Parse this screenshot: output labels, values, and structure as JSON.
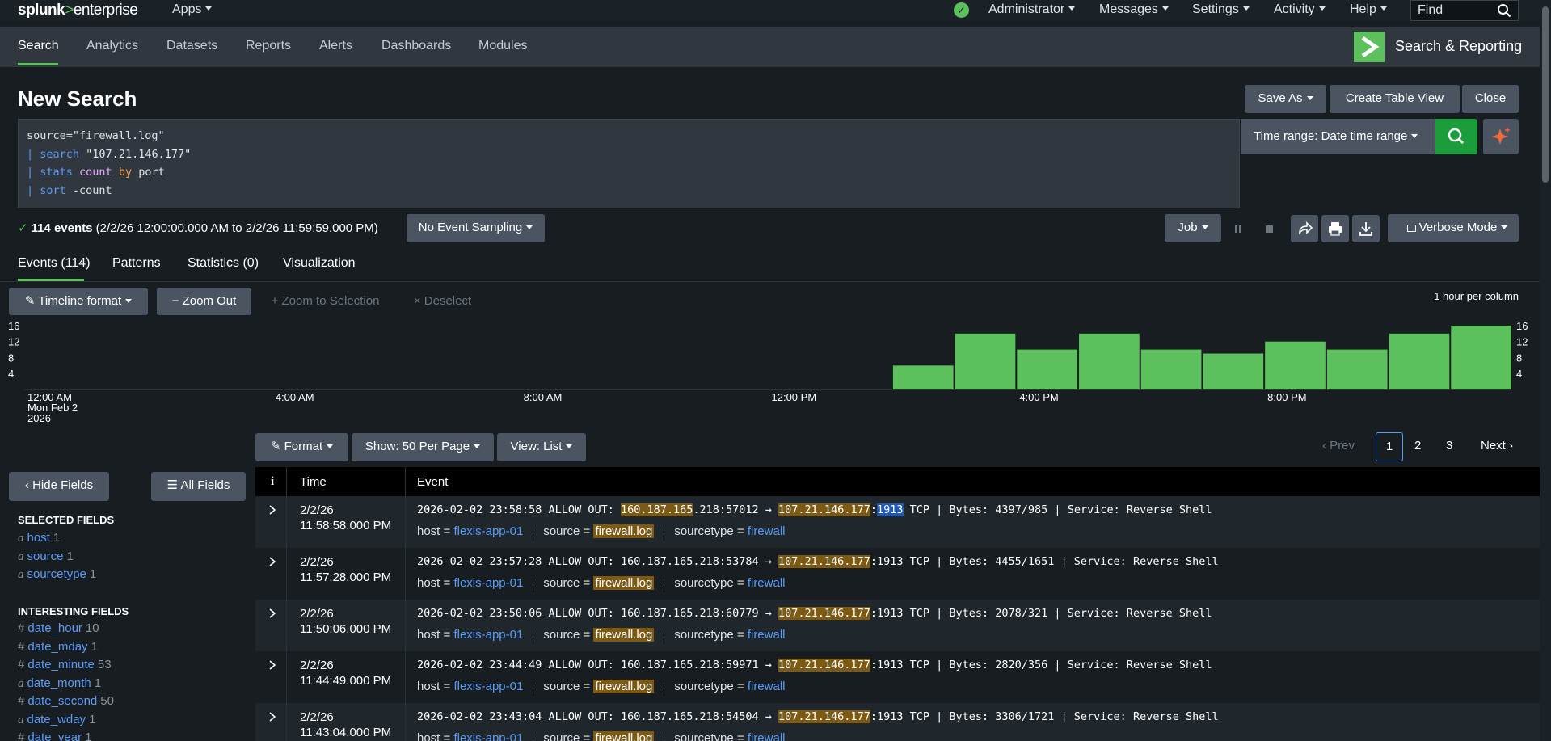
{
  "topbar": {
    "logo_prefix": "splunk",
    "logo_gt": ">",
    "logo_suffix": "enterprise",
    "apps": "Apps",
    "administrator": "Administrator",
    "messages": "Messages",
    "settings": "Settings",
    "activity": "Activity",
    "help": "Help",
    "find_placeholder": "Find"
  },
  "appbar": {
    "tabs": [
      "Search",
      "Analytics",
      "Datasets",
      "Reports",
      "Alerts",
      "Dashboards",
      "Modules"
    ],
    "app_title": "Search & Reporting"
  },
  "page": {
    "title": "New Search",
    "save_as": "Save As",
    "create_table_view": "Create Table View",
    "close": "Close"
  },
  "search": {
    "line1": "source=\"firewall.log\"",
    "pipe": "| ",
    "l2_cmd": "search",
    "l2_arg": " \"107.21.146.177\"",
    "l3_cmd": "stats",
    "l3_fn": "count",
    "l3_by": "by",
    "l3_arg": " port",
    "l4_cmd": "sort",
    "l4_arg": " -count",
    "time_range": "Time range: Date time range"
  },
  "summary": {
    "events": "114 events",
    "range": "(2/2/26 12:00:00.000 AM to 2/2/26 11:59:59.000 PM)",
    "sampling": "No Event Sampling",
    "job": "Job",
    "mode": "Verbose Mode"
  },
  "tabs": {
    "events": "Events (114)",
    "patterns": "Patterns",
    "statistics": "Statistics (0)",
    "visualization": "Visualization"
  },
  "timeline": {
    "format": "Timeline format",
    "zoom_out": "Zoom Out",
    "zoom_selection": "Zoom to Selection",
    "deselect": "Deselect",
    "per_column": "1 hour per column",
    "y_ticks": [
      "16",
      "12",
      "8",
      "4"
    ],
    "x_labels": [
      "12:00 AM",
      "4:00 AM",
      "8:00 AM",
      "12:00 PM",
      "4:00 PM",
      "8:00 PM"
    ],
    "date_line1": "Mon Feb 2",
    "date_line2": "2026",
    "counts": [
      0,
      0,
      0,
      0,
      0,
      0,
      0,
      0,
      0,
      0,
      0,
      0,
      0,
      0,
      6,
      14,
      10,
      14,
      10,
      9,
      12,
      10,
      14,
      16
    ],
    "bar_color": "#5cc05c"
  },
  "results_bar": {
    "format": "Format",
    "show": "Show: 50 Per Page",
    "view": "View: List",
    "prev": "Prev",
    "pages": [
      "1",
      "2",
      "3"
    ],
    "next": "Next"
  },
  "sidebar": {
    "hide_fields": "Hide Fields",
    "all_fields": "All Fields",
    "selected_title": "SELECTED FIELDS",
    "selected": [
      {
        "type": "a",
        "name": "host",
        "count": "1"
      },
      {
        "type": "a",
        "name": "source",
        "count": "1"
      },
      {
        "type": "a",
        "name": "sourcetype",
        "count": "1"
      }
    ],
    "interesting_title": "INTERESTING FIELDS",
    "interesting": [
      {
        "type": "#",
        "name": "date_hour",
        "count": "10"
      },
      {
        "type": "#",
        "name": "date_mday",
        "count": "1"
      },
      {
        "type": "#",
        "name": "date_minute",
        "count": "53"
      },
      {
        "type": "a",
        "name": "date_month",
        "count": "1"
      },
      {
        "type": "#",
        "name": "date_second",
        "count": "50"
      },
      {
        "type": "a",
        "name": "date_wday",
        "count": "1"
      },
      {
        "type": "#",
        "name": "date_year",
        "count": "1"
      }
    ]
  },
  "events_table": {
    "col_info": "i",
    "col_time": "Time",
    "col_event": "Event",
    "meta_host_label": "host = ",
    "meta_source_label": "source = ",
    "meta_sourcetype_label": "sourcetype = ",
    "rows": [
      {
        "date": "2/2/26",
        "time": "11:58:58.000 PM",
        "prefix": "2026-02-02 23:58:58 ALLOW OUT: ",
        "src_a": "160.187.165",
        "src_b": ".218:57012 → ",
        "dst": "107.21.146.177",
        "port": "1913",
        "suffix": " TCP | Bytes: 4397/985 | Service: Reverse Shell",
        "host": "flexis-app-01",
        "source": "firewall.log",
        "sourcetype": "firewall"
      },
      {
        "date": "2/2/26",
        "time": "11:57:28.000 PM",
        "prefix": "2026-02-02 23:57:28 ALLOW OUT: 160.187.165.218:53784 → ",
        "dst": "107.21.146.177",
        "port": ":1913",
        "suffix": " TCP | Bytes: 4455/1651 | Service: Reverse Shell",
        "host": "flexis-app-01",
        "source": "firewall.log",
        "sourcetype": "firewall"
      },
      {
        "date": "2/2/26",
        "time": "11:50:06.000 PM",
        "prefix": "2026-02-02 23:50:06 ALLOW OUT: 160.187.165.218:60779 → ",
        "dst": "107.21.146.177",
        "port": ":1913",
        "suffix": " TCP | Bytes: 2078/321 | Service: Reverse Shell",
        "host": "flexis-app-01",
        "source": "firewall.log",
        "sourcetype": "firewall"
      },
      {
        "date": "2/2/26",
        "time": "11:44:49.000 PM",
        "prefix": "2026-02-02 23:44:49 ALLOW OUT: 160.187.165.218:59971 → ",
        "dst": "107.21.146.177",
        "port": ":1913",
        "suffix": " TCP | Bytes: 2820/356 | Service: Reverse Shell",
        "host": "flexis-app-01",
        "source": "firewall.log",
        "sourcetype": "firewall"
      },
      {
        "date": "2/2/26",
        "time": "11:43:04.000 PM",
        "prefix": "2026-02-02 23:43:04 ALLOW OUT: 160.187.165.218:54504 → ",
        "dst": "107.21.146.177",
        "port": ":1913",
        "suffix": " TCP | Bytes: 3306/1721 | Service: Reverse Shell",
        "host": "flexis-app-01",
        "source": "firewall.log",
        "sourcetype": "firewall"
      }
    ]
  }
}
